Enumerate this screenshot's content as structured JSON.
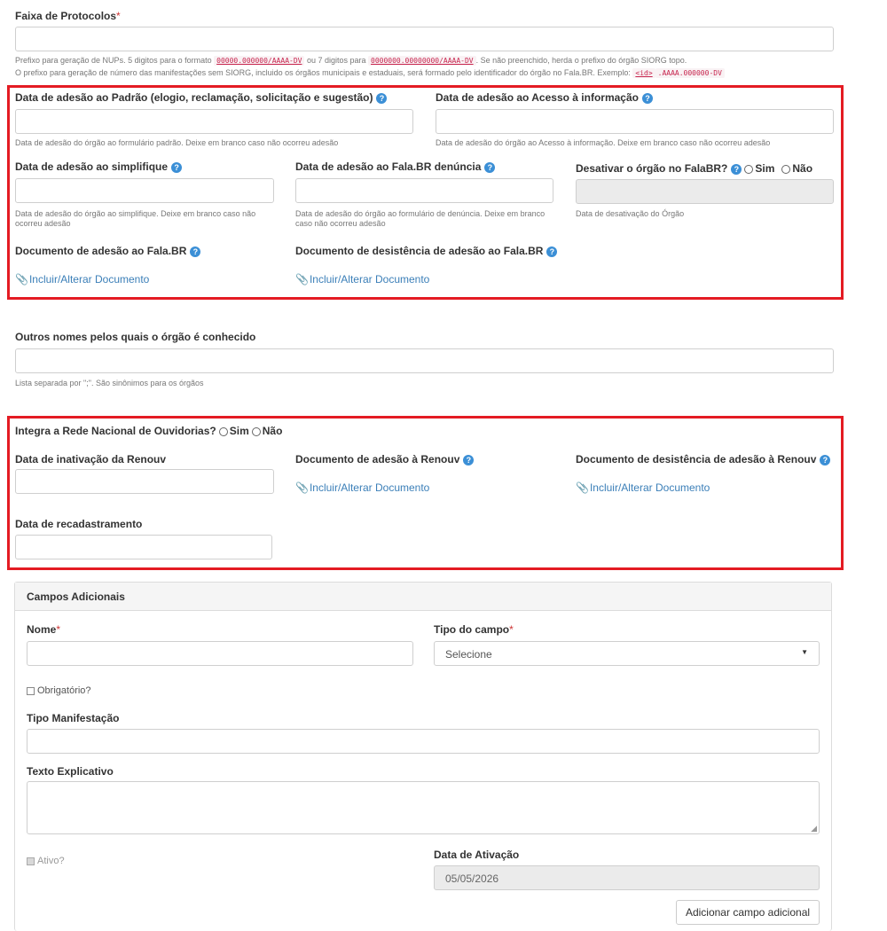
{
  "protocolos": {
    "label": "Faixa de Protocolos",
    "required_mark": "*",
    "help1_a": "Prefixo para geração de NUPs. 5 digitos para o formato ",
    "help1_code1": "00000.000000/AAAA-DV",
    "help1_b": " ou 7 digitos para ",
    "help1_code2": "0000000.00000000/AAAA-DV",
    "help1_c": ". Se não preenchido, herda o prefixo do órgão SIORG topo.",
    "help2_a": "O prefixo para geração de número das manifestações sem SIORG, incluido os órgãos municipais e estaduais, será formado pelo identificador do órgão no Fala.BR. Exemplo: ",
    "help2_code_id": "<id>",
    "help2_code_rest": ".AAAA.000000-DV"
  },
  "adesao": {
    "padrao_label": "Data de adesão ao Padrão (elogio, reclamação, solicitação e sugestão)",
    "padrao_help": "Data de adesão do órgão ao formulário padrão. Deixe em branco caso não ocorreu adesão",
    "acesso_label": "Data de adesão ao Acesso à informação",
    "acesso_help": "Data de adesão do órgão ao Acesso à informação. Deixe em branco caso não ocorreu adesão",
    "simplifique_label": "Data de adesão ao simplifique",
    "simplifique_help": "Data de adesão do órgão ao simplifique. Deixe em branco caso não ocorreu adesão",
    "denuncia_label": "Data de adesão ao Fala.BR denúncia",
    "denuncia_help": "Data de adesão do órgão ao formulário de denúncia. Deixe em branco caso não ocorreu adesão",
    "desativar_label": "Desativar o órgão no FalaBR?",
    "sim": "Sim",
    "nao": "Não",
    "desativacao_help": "Data de desativação do Órgão",
    "doc_adesao_label": "Documento de adesão ao Fala.BR",
    "doc_desistencia_label": "Documento de desistência de adesão ao Fala.BR",
    "incluir": "Incluir/Alterar Documento"
  },
  "outros": {
    "label": "Outros nomes pelos quais o órgão é conhecido",
    "help": "Lista separada por \";\". São sinônimos para os órgãos"
  },
  "renouv": {
    "integra_label": "Integra a Rede Nacional de Ouvidorias?",
    "sim": "Sim",
    "nao": "Não",
    "inativacao_label": "Data de inativação da Renouv",
    "doc_adesao_label": "Documento de adesão à Renouv",
    "doc_desistencia_label": "Documento de desistência de adesão à Renouv",
    "incluir": "Incluir/Alterar Documento",
    "recadastramento_label": "Data de recadastramento"
  },
  "campos": {
    "title": "Campos Adicionais",
    "nome_label": "Nome",
    "required_mark": "*",
    "tipo_campo_label": "Tipo do campo",
    "tipo_campo_value": "Selecione",
    "obrigatorio_label": "Obrigatório?",
    "tipo_manifestacao_label": "Tipo Manifestação",
    "texto_label": "Texto Explicativo",
    "ativo_label": "Ativo?",
    "data_ativacao_label": "Data de Ativação",
    "data_ativacao_value": "05/05/2026",
    "adicionar_button": "Adicionar campo adicional"
  },
  "colors": {
    "highlight_border": "#e41b23",
    "help_icon": "#3b8fd6",
    "link": "#3b7fb8"
  }
}
